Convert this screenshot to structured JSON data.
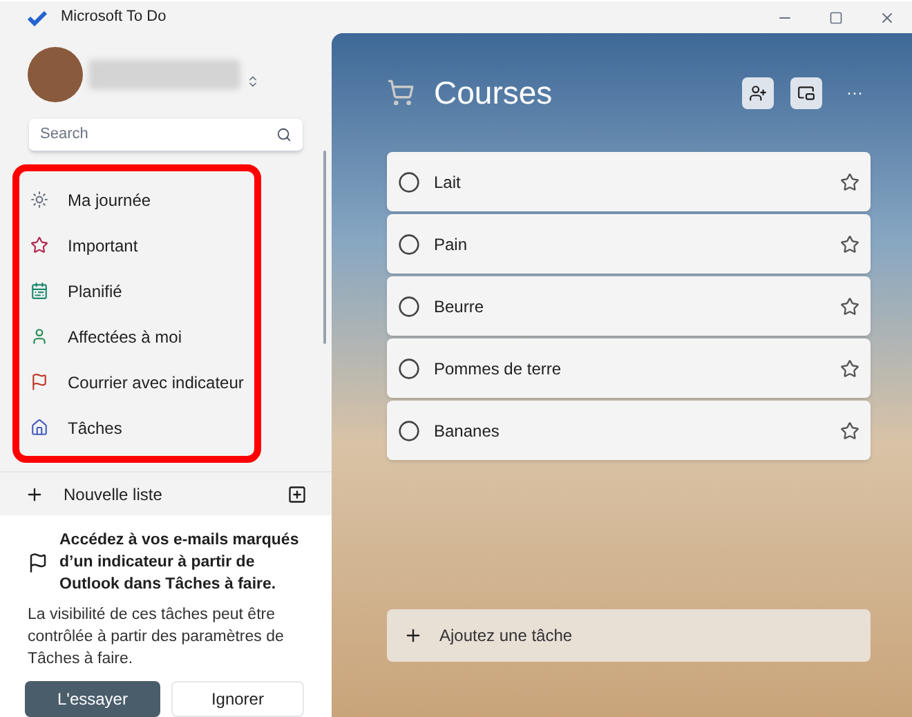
{
  "window": {
    "title": "Microsoft To Do"
  },
  "search": {
    "placeholder": "Search"
  },
  "nav": {
    "highlighted": true,
    "items": [
      {
        "kind": "sun",
        "label": "Ma journée"
      },
      {
        "kind": "star",
        "label": "Important"
      },
      {
        "kind": "calendar",
        "label": "Planifié"
      },
      {
        "kind": "person",
        "label": "Affectées à moi"
      },
      {
        "kind": "flag",
        "label": "Courrier avec indicateur"
      },
      {
        "kind": "home",
        "label": "Tâches"
      }
    ]
  },
  "new_list": {
    "label": "Nouvelle liste"
  },
  "promo": {
    "title": "Accédez à vos e-mails marqués d’un indicateur à partir de Outlook dans Tâches à faire.",
    "body": "La visibilité de ces tâches peut être contrôlée à partir des paramètres de Tâches à faire.",
    "primary": "L'essayer",
    "secondary": "Ignorer"
  },
  "list": {
    "title": "Courses",
    "actions": "···"
  },
  "tasks": [
    {
      "title": "Lait",
      "completed": false,
      "important": false
    },
    {
      "title": "Pain",
      "completed": false,
      "important": false
    },
    {
      "title": "Beurre",
      "completed": false,
      "important": false
    },
    {
      "title": "Pommes de terre",
      "completed": false,
      "important": false
    },
    {
      "title": "Bananes",
      "completed": false,
      "important": false
    }
  ],
  "add_task": {
    "placeholder": "Ajoutez une tâche"
  }
}
